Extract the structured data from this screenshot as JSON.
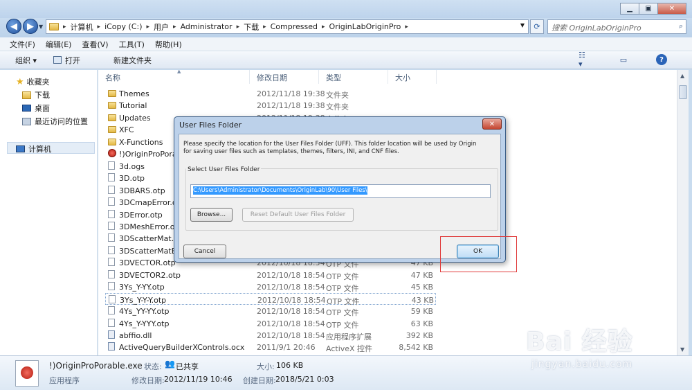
{
  "window": {
    "minimize": "▁",
    "maximize": "▣",
    "close": "✕"
  },
  "address": {
    "segments": [
      "计算机",
      "iCopy (C:)",
      "用户",
      "Administrator",
      "下载",
      "Compressed",
      "OriginLabOriginPro"
    ],
    "search_placeholder": "搜索 OriginLabOriginPro"
  },
  "menubar": [
    "文件(F)",
    "编辑(E)",
    "查看(V)",
    "工具(T)",
    "帮助(H)"
  ],
  "toolbar": {
    "organize": "组织 ▾",
    "open": "打开",
    "new_folder": "新建文件夹"
  },
  "nav": {
    "favorites": "收藏夹",
    "downloads": "下载",
    "desktop": "桌面",
    "recent": "最近访问的位置",
    "computer": "计算机"
  },
  "columns": {
    "name": "名称",
    "date": "修改日期",
    "type": "类型",
    "size": "大小"
  },
  "files": [
    {
      "name": "Themes",
      "date": "2012/11/18 19:38",
      "type": "文件夹",
      "size": "",
      "icon": "folder"
    },
    {
      "name": "Tutorial",
      "date": "2012/11/18 19:38",
      "type": "文件夹",
      "size": "",
      "icon": "folder"
    },
    {
      "name": "Updates",
      "date": "2012/11/18 19:38",
      "type": "文件夹",
      "size": "",
      "icon": "folder"
    },
    {
      "name": "XFC",
      "date": "",
      "type": "",
      "size": "",
      "icon": "folder"
    },
    {
      "name": "X-Functions",
      "date": "",
      "type": "",
      "size": "",
      "icon": "folder"
    },
    {
      "name": "!)OriginProPorab",
      "date": "",
      "type": "",
      "size": "",
      "icon": "origin"
    },
    {
      "name": "3d.ogs",
      "date": "",
      "type": "",
      "size": "",
      "icon": "file"
    },
    {
      "name": "3D.otp",
      "date": "",
      "type": "",
      "size": "",
      "icon": "file"
    },
    {
      "name": "3DBARS.otp",
      "date": "",
      "type": "",
      "size": "",
      "icon": "file"
    },
    {
      "name": "3DCmapError.otp",
      "date": "",
      "type": "",
      "size": "",
      "icon": "file"
    },
    {
      "name": "3DError.otp",
      "date": "",
      "type": "",
      "size": "",
      "icon": "file"
    },
    {
      "name": "3DMeshError.otp",
      "date": "",
      "type": "",
      "size": "",
      "icon": "file"
    },
    {
      "name": "3DScatterMat.otp",
      "date": "",
      "type": "",
      "size": "",
      "icon": "file"
    },
    {
      "name": "3DScatterMatErr",
      "date": "",
      "type": "",
      "size": "",
      "icon": "file"
    },
    {
      "name": "3DVECTOR.otp",
      "date": "2012/10/18 18:54",
      "type": "OTP 文件",
      "size": "47 KB",
      "icon": "file"
    },
    {
      "name": "3DVECTOR2.otp",
      "date": "2012/10/18 18:54",
      "type": "OTP 文件",
      "size": "47 KB",
      "icon": "file"
    },
    {
      "name": "3Ys_Y-YY.otp",
      "date": "2012/10/18 18:54",
      "type": "OTP 文件",
      "size": "45 KB",
      "icon": "file"
    },
    {
      "name": "3Ys_Y-Y-Y.otp",
      "date": "2012/10/18 18:54",
      "type": "OTP 文件",
      "size": "43 KB",
      "icon": "file"
    },
    {
      "name": "4Ys_YY-YY.otp",
      "date": "2012/10/18 18:54",
      "type": "OTP 文件",
      "size": "59 KB",
      "icon": "file"
    },
    {
      "name": "4Ys_Y-YYY.otp",
      "date": "2012/10/18 18:54",
      "type": "OTP 文件",
      "size": "63 KB",
      "icon": "file"
    },
    {
      "name": "abffio.dll",
      "date": "2012/10/18 18:54",
      "type": "应用程序扩展",
      "size": "392 KB",
      "icon": "dll"
    },
    {
      "name": "ActiveQueryBuilderXControls.ocx",
      "date": "2011/9/1 20:46",
      "type": "ActiveX 控件",
      "size": "8,542 KB",
      "icon": "dll"
    }
  ],
  "details": {
    "name": "!)OriginProPorable.exe",
    "kind": "应用程序",
    "state_label": "状态:",
    "state_value": "已共享",
    "size_label": "大小:",
    "size_value": "106 KB",
    "modified_label": "修改日期:",
    "modified_value": "2012/11/19 10:46",
    "created_label": "创建日期:",
    "created_value": "2018/5/21 0:03"
  },
  "dialog": {
    "title": "User Files Folder",
    "close": "✕",
    "description": "Please specify the location for the User Files Folder (UFF). This folder location will be used by Origin for saving user files such as templates, themes, filters, INI, and CNF files.",
    "group_label": "Select User Files Folder",
    "path": "C:\\Users\\Administrator\\Documents\\OriginLab\\90\\User Files\\",
    "browse": "Browse...",
    "reset": "Reset Default User Files Folder",
    "cancel": "Cancel",
    "ok": "OK"
  },
  "watermark": {
    "main": "Bai 经验",
    "sub": "jingyan.baidu.com"
  },
  "colors": {
    "highlight_box": "#e03a3a",
    "selection": "#3399ff",
    "ok_border": "#3c7fb1"
  }
}
